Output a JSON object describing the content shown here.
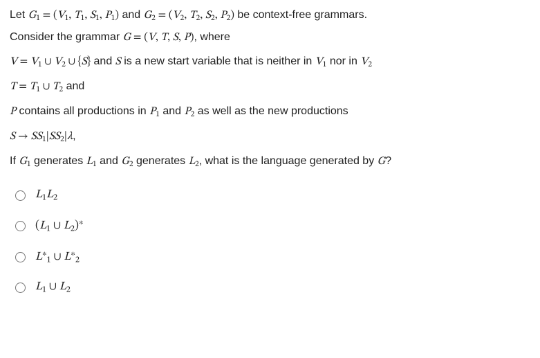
{
  "q": {
    "line1a": "Let ",
    "line1b": " and ",
    "line1c": " be context-free grammars.",
    "line2a": "Consider the grammar ",
    "line2b": ", where",
    "lineV_a": " and ",
    "lineV_b": " is a new start variable that is neither in ",
    "lineV_c": " nor in ",
    "lineT_a": " and",
    "lineP_a": " contains all productions in ",
    "lineP_b": " and ",
    "lineP_c": " as well as the new productions",
    "lineS_comma": ",",
    "lineIf_a": "If ",
    "lineIf_b": " generates ",
    "lineIf_c": " and ",
    "lineIf_d": " generates ",
    "lineIf_e": ", what is the language generated by ",
    "lineIf_f": "?"
  },
  "sym": {
    "G1": "G",
    "G2": "G",
    "G": "G",
    "V1": "V",
    "V2": "V",
    "V": "V",
    "T1": "T",
    "T2": "T",
    "T": "T",
    "S1": "S",
    "S2": "S",
    "S": "S",
    "P1": "P",
    "P2": "P",
    "P": "P",
    "L1": "L",
    "L2": "L",
    "one": "1",
    "two": "2",
    "eq": " = ",
    "comma": ", ",
    "lp": "(",
    "rp": ")",
    "cup": " ∪ ",
    "lb": "{",
    "rb": "}",
    "arrow": " → ",
    "bar": "|",
    "lambda": "λ",
    "star": "∗"
  },
  "options": {
    "a_id": "opt-a",
    "b_id": "opt-b",
    "c_id": "opt-c",
    "d_id": "opt-d"
  }
}
